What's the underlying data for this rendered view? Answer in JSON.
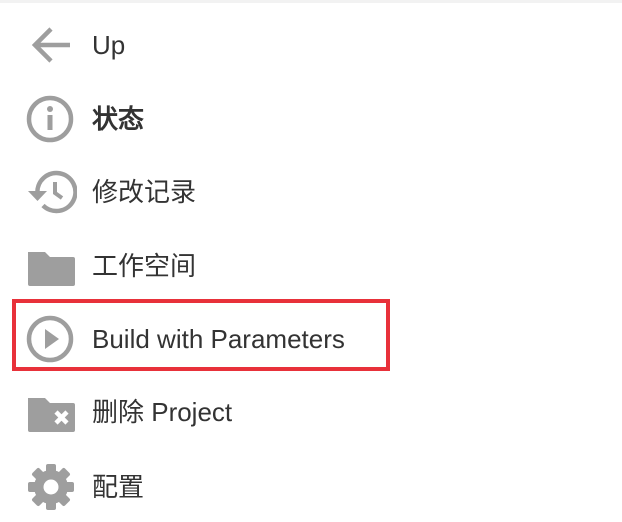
{
  "sidebar": {
    "items": [
      {
        "label": "Up",
        "icon": "arrow-left-icon",
        "bold": false
      },
      {
        "label": "状态",
        "icon": "info-icon",
        "bold": true
      },
      {
        "label": "修改记录",
        "icon": "history-icon",
        "bold": false
      },
      {
        "label": "工作空间",
        "icon": "folder-icon",
        "bold": false
      },
      {
        "label": "Build with Parameters",
        "icon": "play-circle-icon",
        "bold": false,
        "highlighted": true
      },
      {
        "label": "删除 Project",
        "icon": "folder-delete-icon",
        "bold": false
      },
      {
        "label": "配置",
        "icon": "gear-icon",
        "bold": false
      }
    ]
  },
  "colors": {
    "icon_gray": "#9e9e9e",
    "text": "#333333",
    "highlight_border": "#e8313a",
    "background": "#ffffff"
  }
}
